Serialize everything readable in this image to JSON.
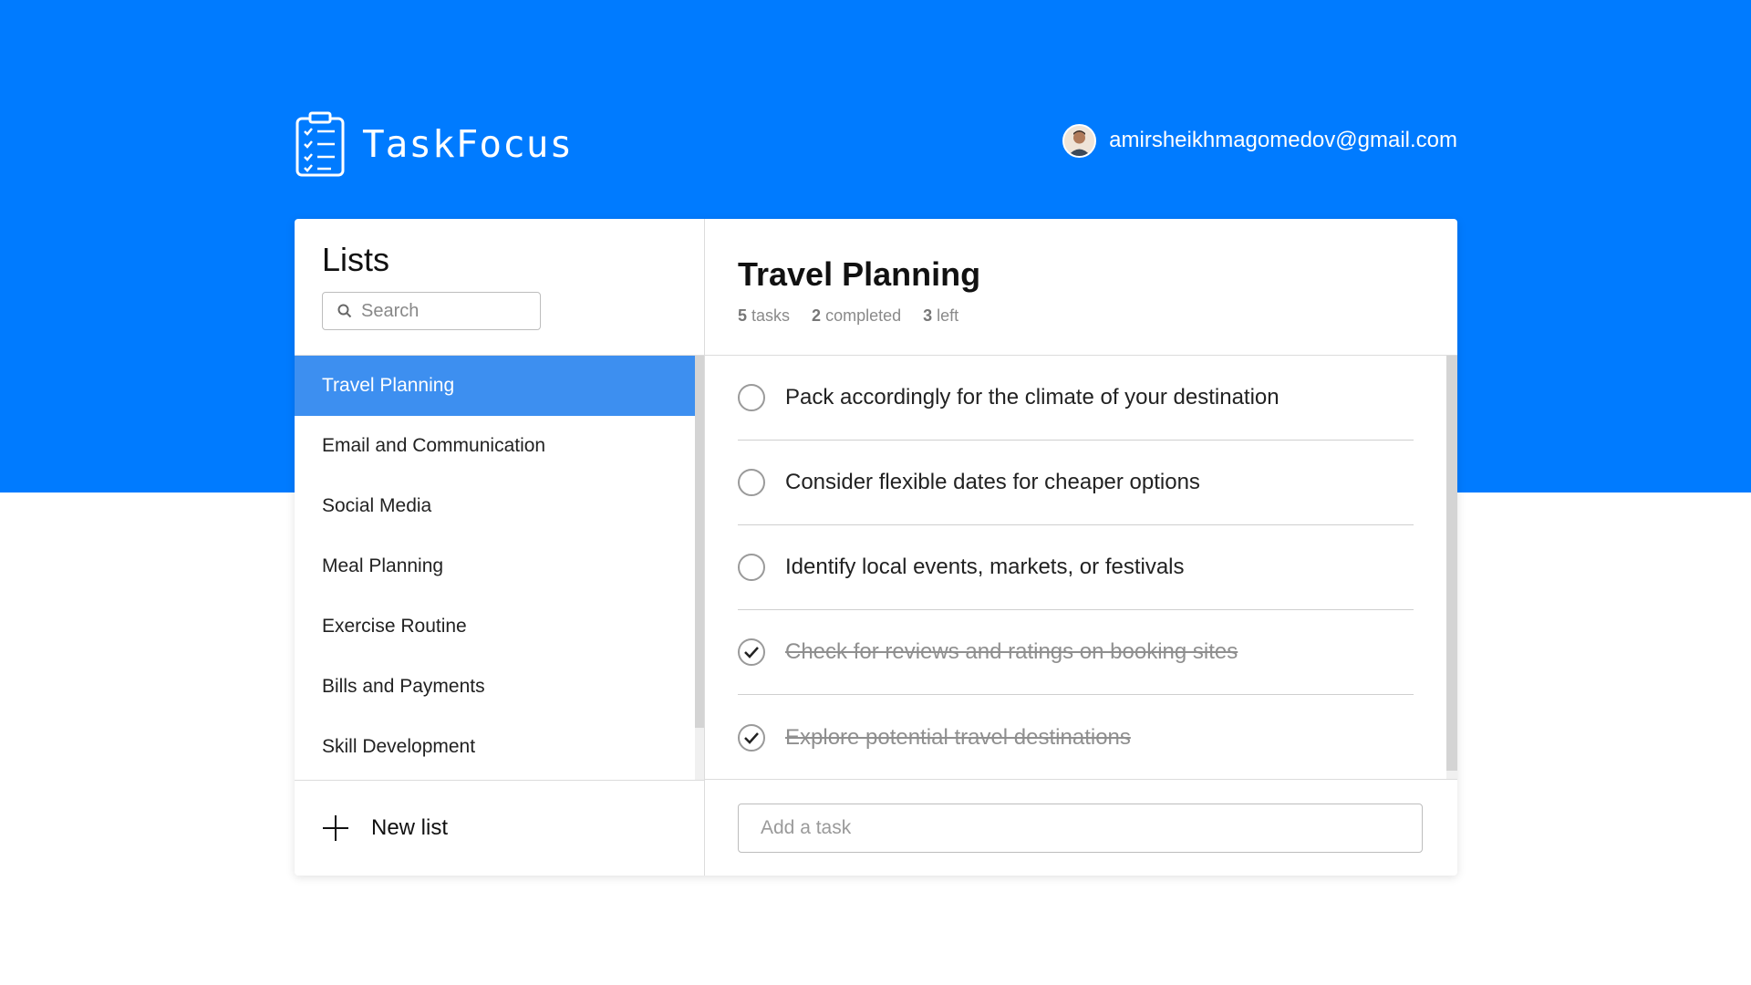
{
  "colors": {
    "brand_blue": "#007bff",
    "active_item": "#3d8ff0"
  },
  "header": {
    "app_name": "TaskFocus",
    "logo_icon": "clipboard-checklist-icon",
    "user_email": "amirsheikhmagomedov@gmail.com"
  },
  "sidebar": {
    "title": "Lists",
    "search_placeholder": "Search",
    "items": [
      {
        "label": "Travel Planning",
        "active": true
      },
      {
        "label": "Email and Communication"
      },
      {
        "label": "Social Media"
      },
      {
        "label": "Meal Planning"
      },
      {
        "label": "Exercise Routine"
      },
      {
        "label": "Bills and Payments"
      },
      {
        "label": "Skill Development"
      }
    ],
    "new_list_label": "New list"
  },
  "main": {
    "title": "Travel Planning",
    "stats": {
      "tasks_count": "5",
      "tasks_label": "tasks",
      "completed_count": "2",
      "completed_label": "completed",
      "left_count": "3",
      "left_label": "left"
    },
    "tasks": [
      {
        "text": "Pack accordingly for the climate of your destination",
        "done": false
      },
      {
        "text": "Consider flexible dates for cheaper options",
        "done": false
      },
      {
        "text": "Identify local events, markets, or festivals",
        "done": false
      },
      {
        "text": "Check for reviews and ratings on booking sites",
        "done": true
      },
      {
        "text": "Explore potential travel destinations",
        "done": true
      }
    ],
    "add_task_placeholder": "Add a task"
  }
}
